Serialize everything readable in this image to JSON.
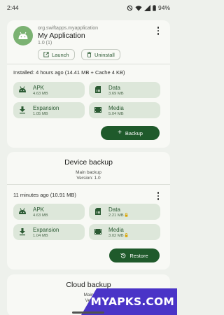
{
  "status_bar": {
    "time": "2:44",
    "battery": "94%"
  },
  "app_card": {
    "package": "org.swiftapps.myapplication",
    "name": "My Application",
    "version": "1.0 (1)",
    "launch_label": "Launch",
    "uninstall_label": "Uninstall",
    "installed_info": "Installed: 4 hours ago (14.41 MB + Cache 4 KB)",
    "tiles": [
      {
        "name": "APK",
        "size": "4.63 MB",
        "icon": "android-icon"
      },
      {
        "name": "Data",
        "size": "3.69 MB",
        "icon": "data-file-icon"
      },
      {
        "name": "Expansion",
        "size": "1.05 MB",
        "icon": "download-icon"
      },
      {
        "name": "Media",
        "size": "5.04 MB",
        "icon": "media-icon"
      }
    ],
    "backup_label": "Backup"
  },
  "device_backup": {
    "title": "Device backup",
    "subtitle": "Main backup",
    "version": "Version: 1.0",
    "info": "11 minutes ago (10.91 MB)",
    "tiles": [
      {
        "name": "APK",
        "size": "4.63 MB",
        "icon": "android-icon"
      },
      {
        "name": "Data",
        "size": "2.21 MB",
        "icon": "data-file-icon",
        "locked": true
      },
      {
        "name": "Expansion",
        "size": "1.04 MB",
        "icon": "download-icon"
      },
      {
        "name": "Media",
        "size": "3.02 MB",
        "icon": "media-icon",
        "locked": true
      }
    ],
    "restore_label": "Restore"
  },
  "cloud_backup": {
    "title": "Cloud backup",
    "subtitle": "Main",
    "version": "Ver"
  },
  "watermark": "MYAPKS.COM",
  "colors": {
    "background": "#eef1ec",
    "card": "#f8f9f5",
    "tile": "#dde7da",
    "accent": "#1f5a2b",
    "accent_text": "#2b5a33",
    "lock": "#d9a400",
    "watermark": "#4a34c7"
  }
}
